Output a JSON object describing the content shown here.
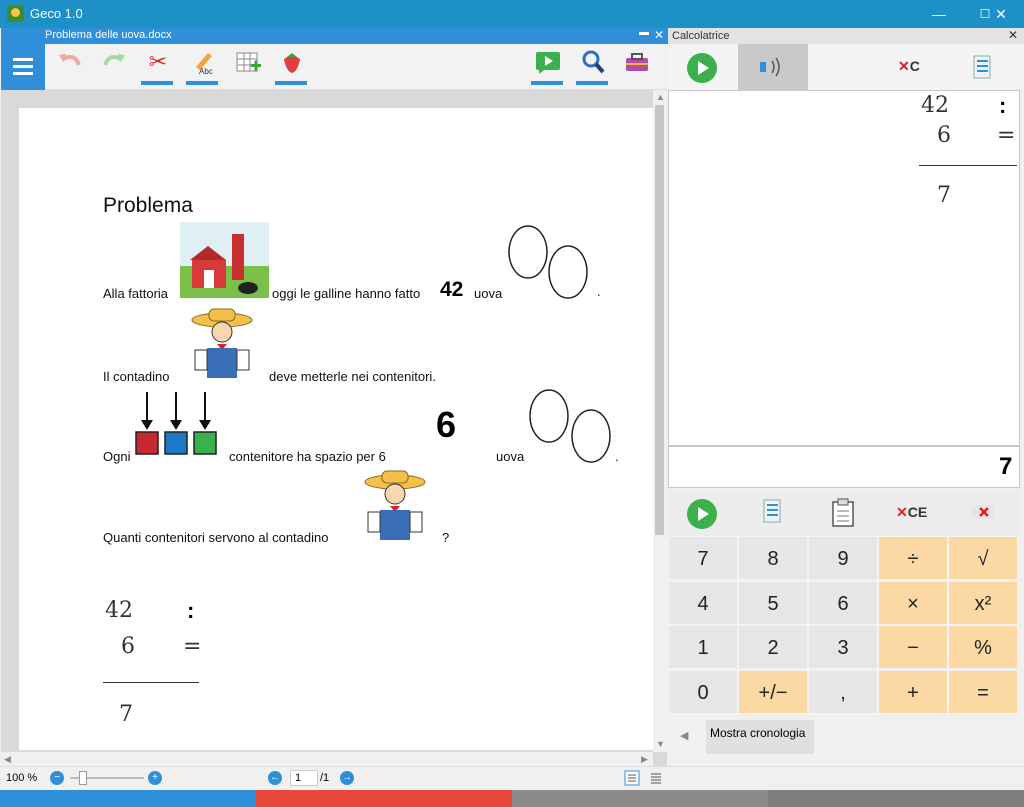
{
  "app": {
    "title": "Geco 1.0",
    "window_controls": {
      "minimize": "—",
      "maximize": "☐",
      "close": "✕"
    }
  },
  "document": {
    "filename": "Problema delle uova.docx",
    "pane_controls": {
      "pin": "▬",
      "close": "✕"
    },
    "toolbar": {
      "menu_icon": "hamburger-icon",
      "items": [
        "undo-icon",
        "redo-icon",
        "scissors-icon",
        "spell-icon",
        "table-icon",
        "strawberry-icon",
        "play-icon",
        "search-icon",
        "toolbox-icon"
      ]
    },
    "heading": "Problema",
    "line1": {
      "a": "Alla fattoria",
      "b": "oggi le galline hanno fatto",
      "number": "42",
      "c": "uova",
      "end": "."
    },
    "line2": {
      "a": "Il contadino",
      "b": "deve metterle nei contenitori."
    },
    "line3": {
      "a": "Ogni",
      "b": "contenitore ha spazio  per 6",
      "number": "6",
      "c": "uova",
      "end": "."
    },
    "line4": {
      "a": "Quanti contenitori servono al contadino",
      "end": "?"
    },
    "calc": {
      "op1": "42",
      "op_symbol": ":",
      "op2": "6",
      "eq": "=",
      "result": "7"
    }
  },
  "status": {
    "zoom": "100 %",
    "page_current": "1",
    "page_total": "/1",
    "zoom_level": 0.18
  },
  "calculator": {
    "header": "Calcolatrice",
    "toolbar": {
      "clear_label": "C"
    },
    "display": {
      "op1": "42",
      "op_symbol": ":",
      "op2": "6",
      "eq": "=",
      "result": "7"
    },
    "result": "7",
    "actions": {
      "ce_label": "CE"
    },
    "keys": [
      [
        "7",
        "8",
        "9",
        "÷",
        "√"
      ],
      [
        "4",
        "5",
        "6",
        "×",
        "x²"
      ],
      [
        "1",
        "2",
        "3",
        "−",
        "%"
      ],
      [
        "0",
        "+/−",
        ",",
        "+",
        "="
      ]
    ],
    "history_button": "Mostra cronologia"
  },
  "colors": {
    "accent": "#2f8fd8",
    "titlebar": "#1e90c8",
    "operator_key": "#fcd9a4",
    "bottom_strip": [
      "#2f8fd8",
      "#e8483a",
      "#8a8a8a",
      "#8a8a8a"
    ]
  }
}
